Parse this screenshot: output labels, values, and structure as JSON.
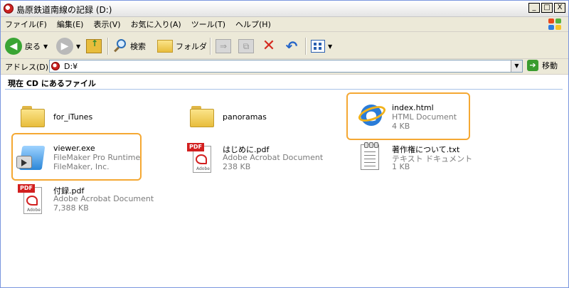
{
  "window": {
    "title": "島原鉄道南線の記録 (D:)",
    "controls": {
      "minimize": "_",
      "maximize": "□",
      "close": "X"
    }
  },
  "menu": [
    "ファイル(F)",
    "編集(E)",
    "表示(V)",
    "お気に入り(A)",
    "ツール(T)",
    "ヘルプ(H)"
  ],
  "toolbar": {
    "back_label": "戻る",
    "search_label": "検索",
    "folders_label": "フォルダ"
  },
  "address": {
    "label": "アドレス(D)",
    "value": "D:¥",
    "go_label": "移動"
  },
  "content": {
    "section_header": "現在 CD にあるファイル",
    "items": [
      {
        "name": "for_iTunes",
        "type_line": "",
        "size_line": "",
        "icon": "folder-icon"
      },
      {
        "name": "panoramas",
        "type_line": "",
        "size_line": "",
        "icon": "folder-icon"
      },
      {
        "name": "index.html",
        "type_line": "HTML Document",
        "size_line": "4 KB",
        "icon": "internet-explorer-icon",
        "highlighted": true
      },
      {
        "name": "viewer.exe",
        "type_line": "FileMaker Pro Runtime",
        "size_line": "FileMaker, Inc.",
        "icon": "filemaker-icon",
        "highlighted": true
      },
      {
        "name": "はじめに.pdf",
        "type_line": "Adobe Acrobat Document",
        "size_line": "238 KB",
        "icon": "pdf-icon"
      },
      {
        "name": "著作権について.txt",
        "type_line": "テキスト ドキュメント",
        "size_line": "1 KB",
        "icon": "text-file-icon"
      },
      {
        "name": "付録.pdf",
        "type_line": "Adobe Acrobat Document",
        "size_line": "7,388 KB",
        "icon": "pdf-icon"
      }
    ]
  },
  "colors": {
    "highlight": "#f5a833",
    "section_rule": "#a9c3e8",
    "chrome": "#ece9d8"
  }
}
